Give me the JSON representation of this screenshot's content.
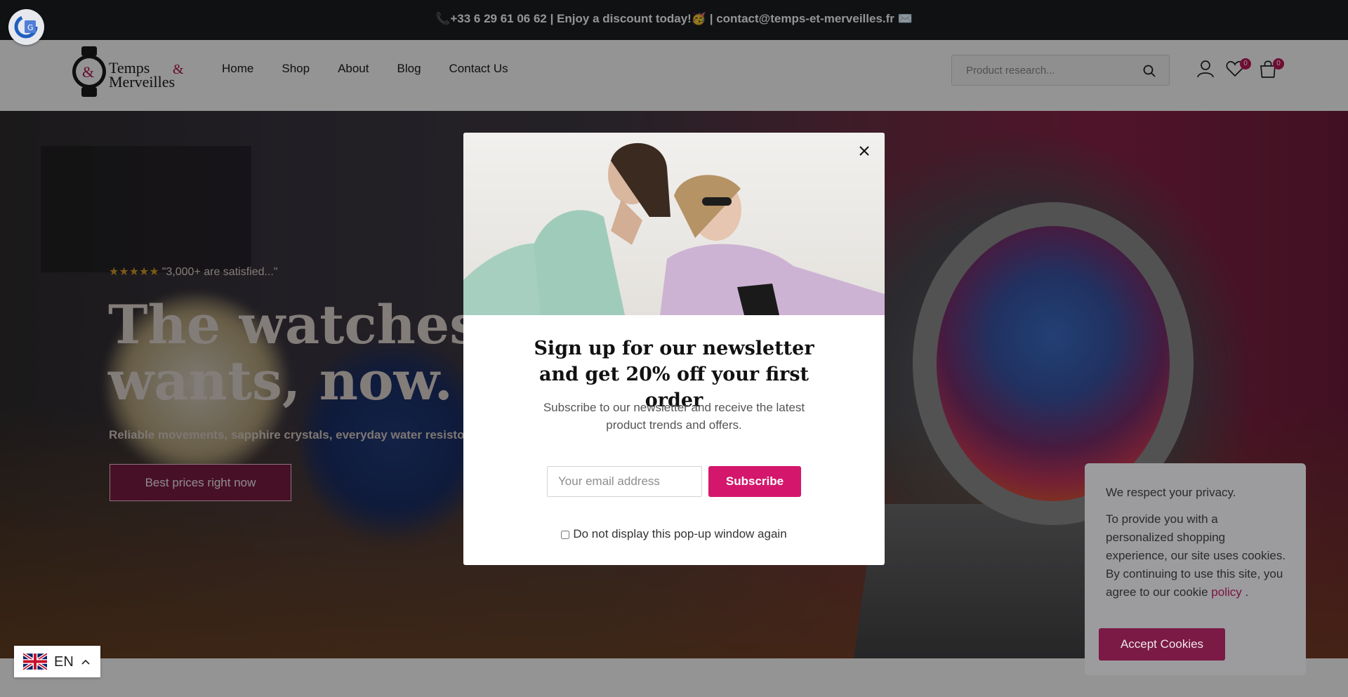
{
  "topbar": {
    "text": "📞+33 6 29 61 06 62 | Enjoy a discount today!🥳 | contact@temps-et-merveilles.fr ✉️"
  },
  "header": {
    "logo": {
      "line1": "Temps",
      "ampersand": "&",
      "line2": "Merveilles"
    },
    "nav": [
      {
        "label": "Home"
      },
      {
        "label": "Shop"
      },
      {
        "label": "About"
      },
      {
        "label": "Blog"
      },
      {
        "label": "Contact Us"
      }
    ],
    "search": {
      "placeholder": "Product research..."
    },
    "wishlist_count": "0",
    "cart_count": "0"
  },
  "hero": {
    "rating_stars": "★★★★★",
    "rating_text": "\"3,000+ are satisfied...\"",
    "title_visible": "The watches e\nwants, now.",
    "subtitle_visible": "Reliable movements, sapphire crystals, everyday water resisto",
    "cta": "Best prices right now",
    "slides": 2,
    "active_slide": 1
  },
  "popup": {
    "title": "Sign up for our newsletter and get 20% off your first order",
    "description": "Subscribe to our newsletter and receive the latest product trends and offers.",
    "email_placeholder": "Your email address",
    "subscribe": "Subscribe",
    "dont_show": "Do not display this pop-up window again"
  },
  "cookie": {
    "title": "We respect your privacy.",
    "text": "To provide you with a personalized shopping experience, our site uses cookies. By continuing to use this site, you agree to our cookie",
    "link": "policy",
    "period": " .",
    "accept": "Accept Cookies"
  },
  "language": {
    "code": "EN"
  },
  "colors": {
    "accent": "#d4176c",
    "brand_dark": "#7a1a45",
    "topbar": "#1d1e22"
  },
  "icons": [
    "translate-icon",
    "search-icon",
    "user-icon",
    "heart-icon",
    "bag-icon",
    "close-icon",
    "uk-flag-icon",
    "chevron-up-icon"
  ]
}
